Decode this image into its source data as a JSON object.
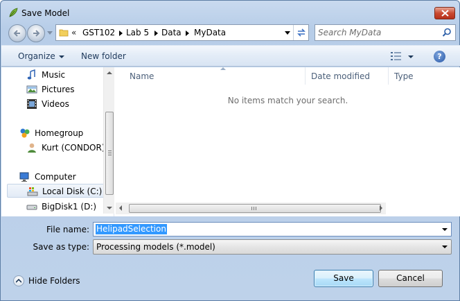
{
  "window": {
    "title": "Save Model",
    "app_icon": "leaf-icon",
    "close_icon": "close-icon"
  },
  "address": {
    "overflow": "«",
    "crumbs": [
      "GST102",
      "Lab 5",
      "Data",
      "MyData"
    ]
  },
  "search": {
    "placeholder": "Search MyData"
  },
  "toolbar": {
    "organize_label": "Organize",
    "new_folder_label": "New folder",
    "help_label": "?"
  },
  "nav": {
    "items": [
      {
        "label": "Music",
        "icon": "music-icon"
      },
      {
        "label": "Pictures",
        "icon": "pictures-icon"
      },
      {
        "label": "Videos",
        "icon": "videos-icon"
      },
      {
        "label": "Homegroup",
        "icon": "homegroup-icon"
      },
      {
        "label": "Kurt (CONDOR)",
        "icon": "user-icon"
      },
      {
        "label": "Computer",
        "icon": "computer-icon"
      },
      {
        "label": "Local Disk (C:)",
        "icon": "local-disk-icon",
        "selected": true
      },
      {
        "label": "BigDisk1 (D:)",
        "icon": "drive-icon"
      }
    ]
  },
  "files": {
    "columns": [
      "Name",
      "Date modified",
      "Type"
    ],
    "empty_message": "No items match your search."
  },
  "form": {
    "file_name_label": "File name:",
    "file_name_value": "HelipadSelection",
    "save_as_type_label": "Save as type:",
    "save_as_type_value": "Processing models (*.model)"
  },
  "footer": {
    "hide_folders_label": "Hide Folders",
    "save_label": "Save",
    "cancel_label": "Cancel"
  },
  "colors": {
    "selection": "#3399ff",
    "chrome": "#bed2ea",
    "close_button": "#c94a31"
  }
}
